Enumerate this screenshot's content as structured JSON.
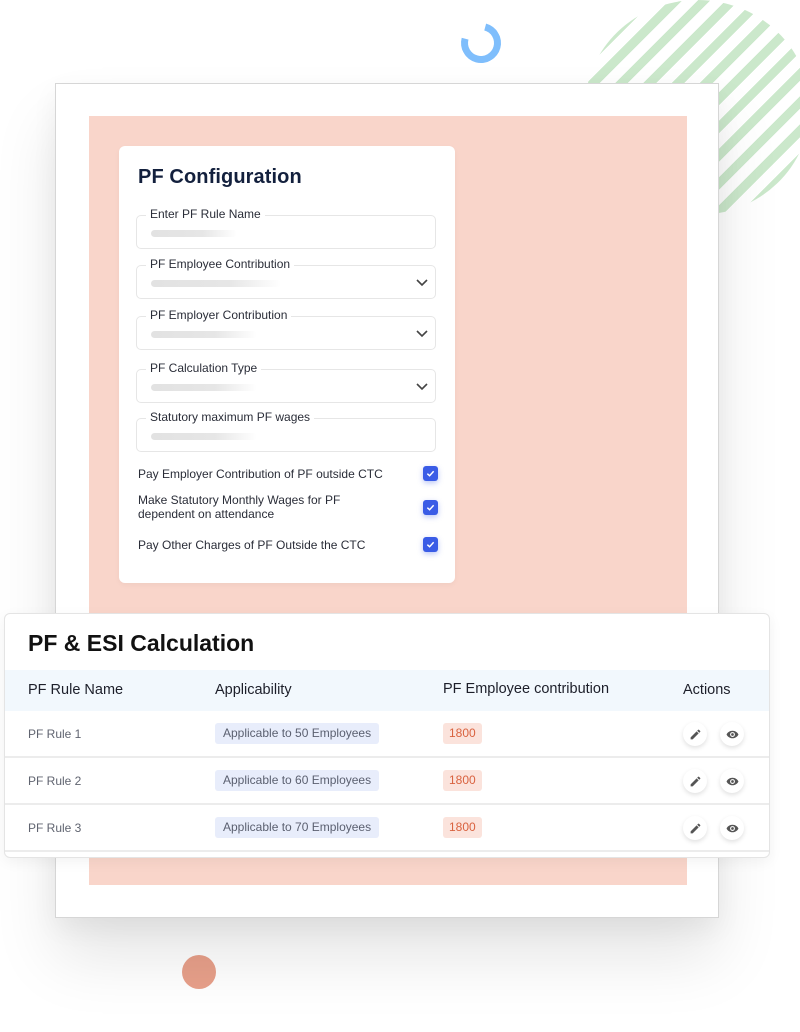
{
  "config": {
    "title": "PF Configuration",
    "fields": [
      {
        "label": "Enter PF Rule Name",
        "type": "text",
        "value": ""
      },
      {
        "label": "PF Employee Contribution",
        "type": "select",
        "value": ""
      },
      {
        "label": "PF Employer Contribution",
        "type": "select",
        "value": ""
      },
      {
        "label": "PF Calculation Type",
        "type": "select",
        "value": ""
      },
      {
        "label": "Statutory maximum PF wages",
        "type": "text",
        "value": ""
      }
    ],
    "checkboxes": [
      {
        "label": "Pay Employer Contribution of PF outside CTC",
        "checked": true
      },
      {
        "label": "Make Statutory Monthly Wages for PF dependent on attendance",
        "checked": true
      },
      {
        "label": "Pay Other Charges of PF Outside the CTC",
        "checked": true
      }
    ]
  },
  "table": {
    "title": "PF & ESI Calculation",
    "headers": [
      "PF Rule Name",
      "Applicability",
      "PF Employee contribution",
      "Actions"
    ],
    "rows": [
      {
        "name": "PF Rule 1",
        "applicability": "Applicable to 50 Employees",
        "contribution": "1800"
      },
      {
        "name": "PF Rule 2",
        "applicability": "Applicable to 60 Employees",
        "contribution": "1800"
      },
      {
        "name": "PF Rule 3",
        "applicability": "Applicable to 70 Employees",
        "contribution": "1800"
      }
    ],
    "actions": [
      {
        "icon": "pencil-icon",
        "label": "edit"
      },
      {
        "icon": "eye-icon",
        "label": "view"
      }
    ]
  },
  "colors": {
    "accent": "#3a5ce6",
    "peach_panel": "#f9d5ca",
    "badge_blue_bg": "#e8edfb",
    "badge_red_bg": "#fbe3dc",
    "badge_red_text": "#d9623f",
    "table_header_bg": "#f2f8fd"
  }
}
